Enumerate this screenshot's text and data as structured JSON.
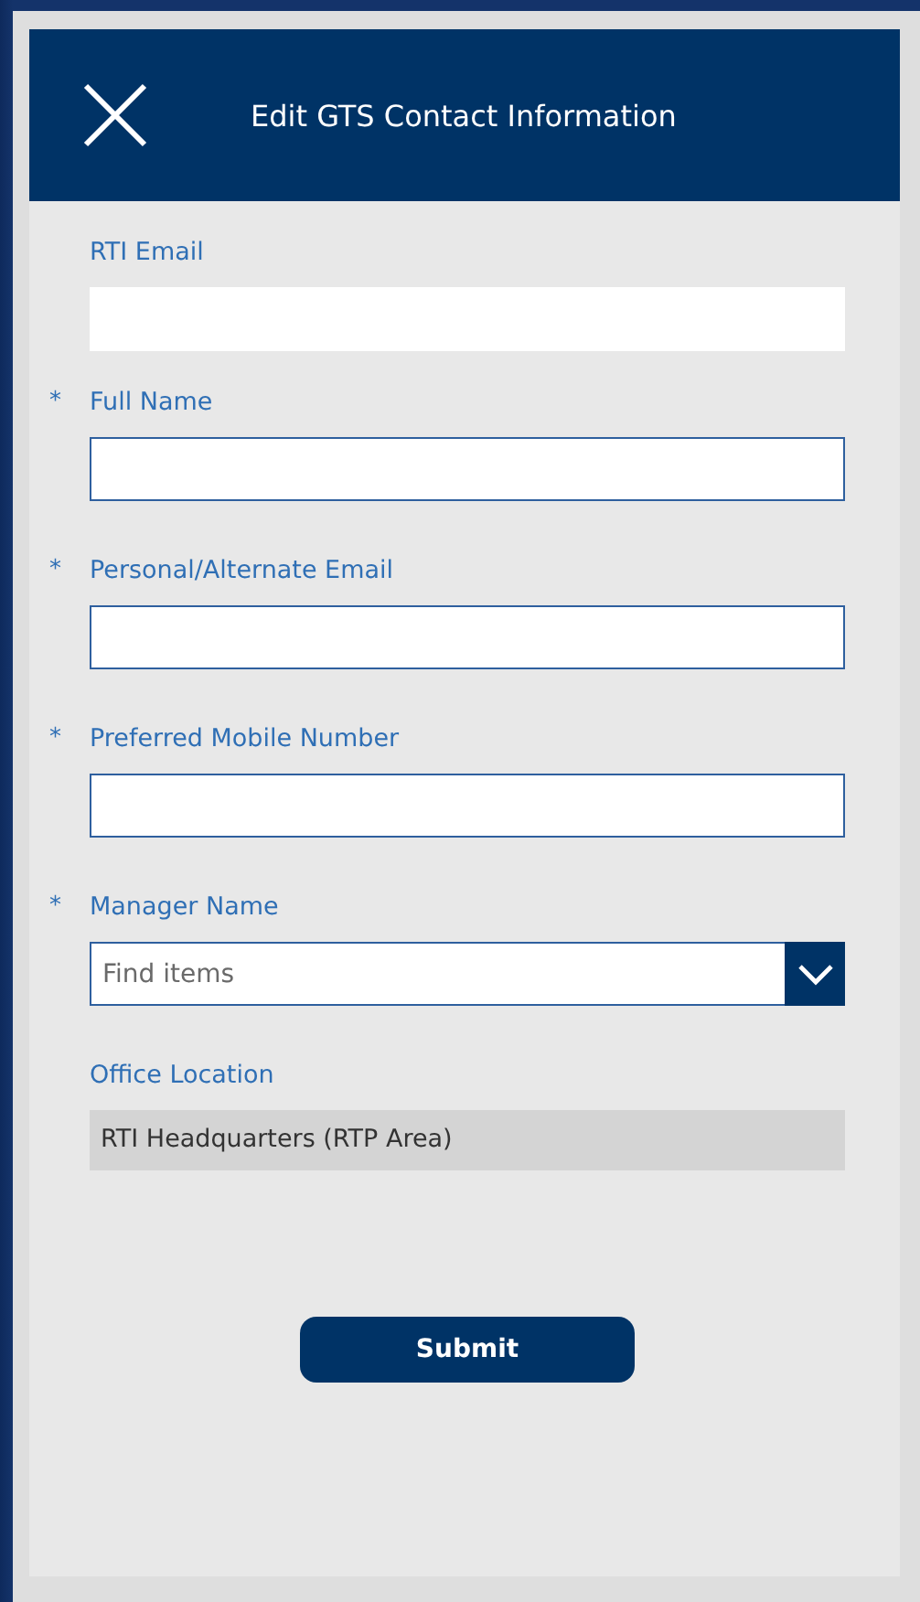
{
  "header": {
    "title": "Edit GTS Contact Information"
  },
  "fields": [
    {
      "kind": "readonly",
      "label": "RTI Email",
      "required": false
    },
    {
      "kind": "text",
      "label": "Full Name",
      "required": true
    },
    {
      "kind": "text",
      "label": "Personal/Alternate Email",
      "required": true
    },
    {
      "kind": "text",
      "label": "Preferred Mobile Number",
      "required": true
    },
    {
      "kind": "dropdown",
      "label": "Manager Name",
      "required": true,
      "placeholder": "Find items"
    },
    {
      "kind": "display",
      "label": "Office Location",
      "required": false,
      "value": "RTI Headquarters (RTP Area)"
    }
  ],
  "required_mark": "*",
  "submit": {
    "label": "Submit"
  }
}
